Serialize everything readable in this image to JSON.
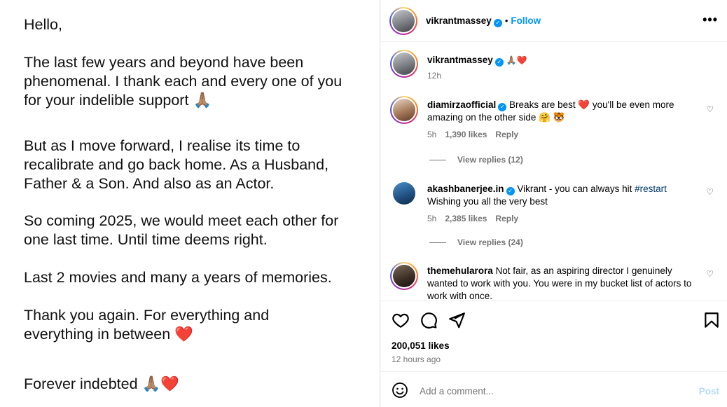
{
  "post_image": {
    "greeting": "Hello,",
    "p1": "The last few years and beyond have been phenomenal. I thank each and every one of you for your indelible support",
    "p1_emoji": "🙏🏽",
    "p2": "But as I move forward, I realise its time to recalibrate and go back home. As a Husband, Father & a Son. And also as an Actor.",
    "p3": "So coming 2025, we would meet each other for one last time. Until time deems right.",
    "p4": "Last 2 movies and many a years of memories.",
    "p5": "Thank you again. For everything and everything in between",
    "p5_emoji": "❤️",
    "p6": "Forever indebted",
    "p6_emoji": "🙏🏽❤️"
  },
  "header": {
    "username": "vikrantmassey",
    "dot": "•",
    "follow_label": "Follow",
    "more_label": "•••"
  },
  "caption": {
    "username": "vikrantmassey",
    "text": "🙏🏽❤️",
    "time": "12h"
  },
  "comments": [
    {
      "username": "diamirzaofficial",
      "text": "Breaks are best ❤️ you'll be even more amazing on the other side 🤗 🐯",
      "time": "5h",
      "likes": "1,390 likes",
      "reply": "Reply",
      "view_replies": "View replies (12)"
    },
    {
      "username": "akashbanerjee.in",
      "text_before": "Vikrant - you can always hit ",
      "hashtag": "#restart",
      "text_after": "Wishing you all the very best",
      "time": "5h",
      "likes": "2,385 likes",
      "reply": "Reply",
      "view_replies": "View replies (24)"
    },
    {
      "username": "themehularora",
      "text": "Not fair, as an aspiring director I genuinely wanted to work with you. You were in my bucket list of actors to work with once."
    }
  ],
  "actions": {
    "likes": "200,051 likes",
    "time": "12 hours ago",
    "icons": [
      "heart-icon",
      "comment-icon",
      "share-icon",
      "bookmark-icon"
    ]
  },
  "add_comment": {
    "placeholder": "Add a comment...",
    "post_label": "Post"
  },
  "colors": {
    "accent": "#0095f6",
    "muted": "#737373",
    "hashtag": "#00376b",
    "post_disabled": "#b3dbff"
  }
}
